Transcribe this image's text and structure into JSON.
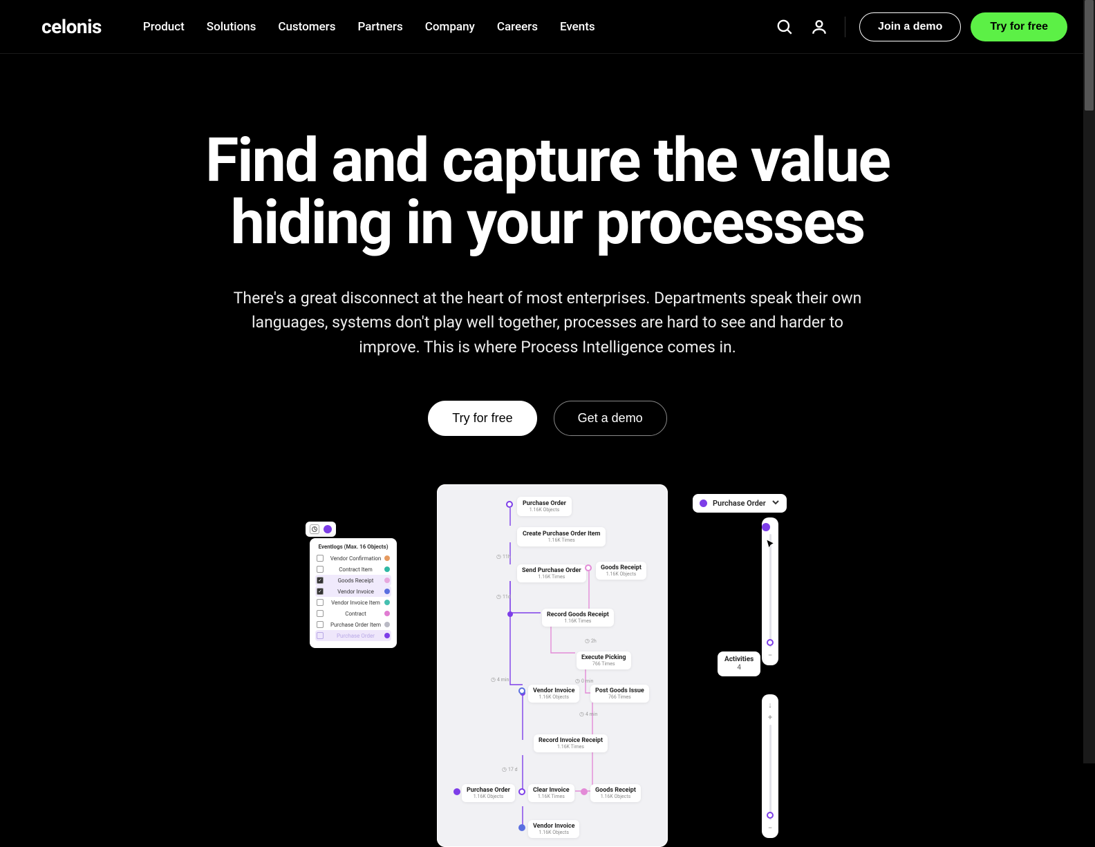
{
  "brand": "celonis",
  "nav": {
    "items": [
      "Product",
      "Solutions",
      "Customers",
      "Partners",
      "Company",
      "Careers",
      "Events"
    ],
    "join_demo": "Join a demo",
    "try_free": "Try for free"
  },
  "hero": {
    "headline": "Find and capture the value hiding in your processes",
    "sub": "There's a great disconnect at the heart of most enterprises. Departments speak their own languages, systems don't play well together, processes are hard to see and harder to improve. This is where Process Intelligence comes in.",
    "cta_primary": "Try for free",
    "cta_secondary": "Get a demo"
  },
  "eventlogs": {
    "title": "Eventlogs (Max. 16 Objects)",
    "rows": [
      {
        "label": "Vendor Confirmation",
        "checked": false,
        "color": "#e69a5f"
      },
      {
        "label": "Contract Item",
        "checked": false,
        "color": "#2fb8a4"
      },
      {
        "label": "Goods Receipt",
        "checked": true,
        "color": "#e7a8de"
      },
      {
        "label": "Vendor Invoice",
        "checked": true,
        "color": "#5a6fe0"
      },
      {
        "label": "Vendor Invoice Item",
        "checked": false,
        "color": "#45c0b0"
      },
      {
        "label": "Contract",
        "checked": false,
        "color": "#e07cd2"
      },
      {
        "label": "Purchase Order Item",
        "checked": false,
        "color": "#b9b9c4"
      },
      {
        "label": "Purchase Order",
        "checked": false,
        "color": "#7d3ee8",
        "muted": true
      }
    ]
  },
  "flow": {
    "start": {
      "label": "Purchase Order",
      "sub": "1.16K Objects"
    },
    "n1": {
      "label": "Create Purchase Order Item",
      "sub": "1.16K Times"
    },
    "e1": "11h",
    "n2": {
      "label": "Send Purchase Order",
      "sub": "1.16K Times"
    },
    "side_gr": {
      "label": "Goods Receipt",
      "sub": "1.16K Objects"
    },
    "e2": "11d",
    "n3": {
      "label": "Record Goods Receipt",
      "sub": "1.16K Times"
    },
    "e3": "2h",
    "n4": {
      "label": "Execute Picking",
      "sub": "766 Times"
    },
    "e4": "4 min",
    "e5": "0 min",
    "n5": {
      "label": "Vendor Invoice",
      "sub": "1.16K Objects"
    },
    "n6": {
      "label": "Post Goods Issue",
      "sub": "766 Times"
    },
    "e6": "4 min",
    "n7": {
      "label": "Record Invoice Receipt",
      "sub": "1.16K Times"
    },
    "e7": "17 d",
    "po_left": {
      "label": "Purchase Order",
      "sub": "1.16K Objects"
    },
    "n8": {
      "label": "Clear Invoice",
      "sub": "1.16K Times"
    },
    "gr_right": {
      "label": "Goods Receipt",
      "sub": "1.16K Objects"
    },
    "n9": {
      "label": "Vendor Invoice",
      "sub": "1.16K Objects"
    }
  },
  "right": {
    "dropdown": "Purchase Order",
    "activities": {
      "label": "Activities",
      "value": "4"
    }
  },
  "colors": {
    "accent_green": "#5cf046",
    "accent_purple": "#7d3ee8"
  }
}
